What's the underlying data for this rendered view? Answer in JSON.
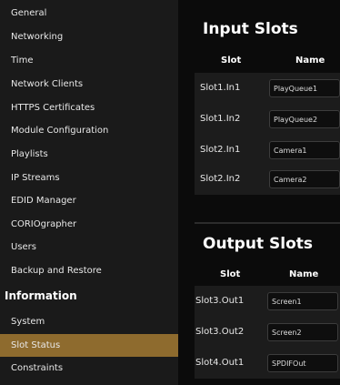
{
  "sidebar": {
    "items_top": [
      {
        "label": "General",
        "name": "nav-general"
      },
      {
        "label": "Networking",
        "name": "nav-networking"
      },
      {
        "label": "Time",
        "name": "nav-time"
      },
      {
        "label": "Network Clients",
        "name": "nav-network-clients"
      },
      {
        "label": "HTTPS Certificates",
        "name": "nav-https-certificates"
      },
      {
        "label": "Module Configuration",
        "name": "nav-module-configuration"
      },
      {
        "label": "Playlists",
        "name": "nav-playlists"
      },
      {
        "label": "IP Streams",
        "name": "nav-ip-streams"
      },
      {
        "label": "EDID Manager",
        "name": "nav-edid-manager"
      },
      {
        "label": "CORIOgrapher",
        "name": "nav-coriographer"
      },
      {
        "label": "Users",
        "name": "nav-users"
      },
      {
        "label": "Backup and Restore",
        "name": "nav-backup-restore"
      }
    ],
    "section_information": "Information",
    "items_info": [
      {
        "label": "System",
        "name": "nav-system"
      },
      {
        "label": "Slot Status",
        "name": "nav-slot-status",
        "active": true
      },
      {
        "label": "Constraints",
        "name": "nav-constraints"
      }
    ]
  },
  "input_slots": {
    "title": "Input Slots",
    "col_slot": "Slot",
    "col_name": "Name",
    "rows": [
      {
        "slot": "Slot1.In1",
        "name": "PlayQueue1"
      },
      {
        "slot": "Slot1.In2",
        "name": "PlayQueue2"
      },
      {
        "slot": "Slot2.In1",
        "name": "Camera1"
      },
      {
        "slot": "Slot2.In2",
        "name": "Camera2"
      }
    ]
  },
  "output_slots": {
    "title": "Output Slots",
    "col_slot": "Slot",
    "col_name": "Name",
    "rows": [
      {
        "slot": "Slot3.Out1",
        "name": "Screen1"
      },
      {
        "slot": "Slot3.Out2",
        "name": "Screen2"
      },
      {
        "slot": "Slot4.Out1",
        "name": "SPDIFOut"
      }
    ]
  },
  "colors": {
    "active_nav": "#8e6b2e",
    "sidebar_bg": "#1a1a1a",
    "main_bg": "#0b0b0b"
  }
}
